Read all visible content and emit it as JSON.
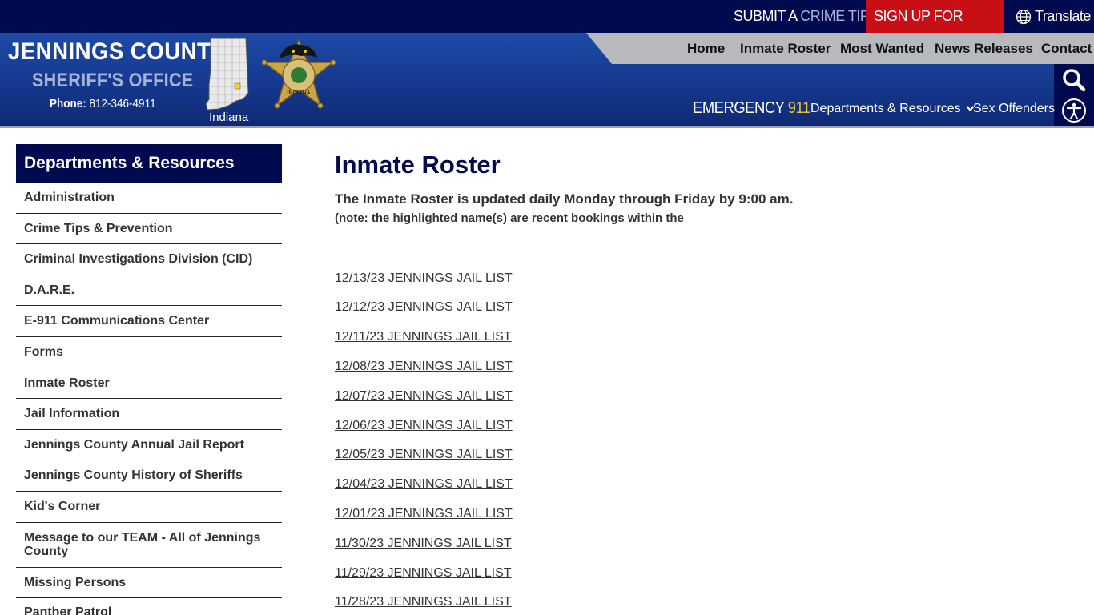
{
  "topbar": {
    "crime_tip_prefix": "SUBMIT A",
    "crime_tip_suffix": "CRIME TIP",
    "alerts": "SIGN UP FOR ALERTS",
    "translate": "Translate"
  },
  "brand": {
    "title": "JENNINGS COUNTY",
    "subtitle": "SHERIFF'S OFFICE",
    "phone_label": "Phone:",
    "phone_number": "812-346-4911",
    "map_label": "Indiana",
    "badge_text": "INDIANA"
  },
  "main_nav": [
    "Home",
    "Inmate Roster",
    "Most Wanted",
    "News Releases",
    "Contact"
  ],
  "sub_nav": {
    "emergency_label": "EMERGENCY",
    "emergency_number": "911",
    "departments": "Departments & Resources",
    "sex_offenders": "Sex Offenders"
  },
  "sidebar": {
    "heading": "Departments & Resources",
    "items": [
      "Administration",
      "Crime Tips & Prevention",
      "Criminal Investigations Division (CID)",
      "D.A.R.E.",
      "E-911 Communications Center",
      "Forms",
      "Inmate Roster",
      "Jail Information",
      "Jennings County Annual Jail Report",
      "Jennings County History of Sheriffs",
      "Kid's Corner",
      "Message to our TEAM - All of Jennings County",
      "Missing Persons",
      "Panther Patrol"
    ]
  },
  "content": {
    "title": "Inmate Roster",
    "intro": "The Inmate Roster is updated daily Monday through Friday by 9:00 am.",
    "note": "(note: the highlighted name(s) are recent bookings within the",
    "links": [
      "12/13/23 JENNINGS JAIL LIST",
      "12/12/23 JENNINGS JAIL LIST",
      "12/11/23 JENNINGS JAIL LIST",
      "12/08/23 JENNINGS JAIL LIST",
      "12/07/23 JENNINGS JAIL LIST",
      "12/06/23 JENNINGS JAIL LIST",
      "12/05/23 JENNINGS JAIL LIST",
      "12/04/23 JENNINGS JAIL LIST",
      "12/01/23 JENNINGS JAIL LIST",
      "11/30/23 JENNINGS JAIL LIST",
      "11/29/23 JENNINGS JAIL LIST",
      "11/28/23 JENNINGS JAIL LIST"
    ]
  },
  "colors": {
    "navy": "#020a4f",
    "alert_red": "#c80f16",
    "emergency_yellow": "#f2c230",
    "nav_gray": "#b8b9bd"
  },
  "icons": {
    "search": "search-icon",
    "accessibility": "accessibility-icon",
    "translate": "globe-icon",
    "dropdown": "chevron-down-icon"
  }
}
